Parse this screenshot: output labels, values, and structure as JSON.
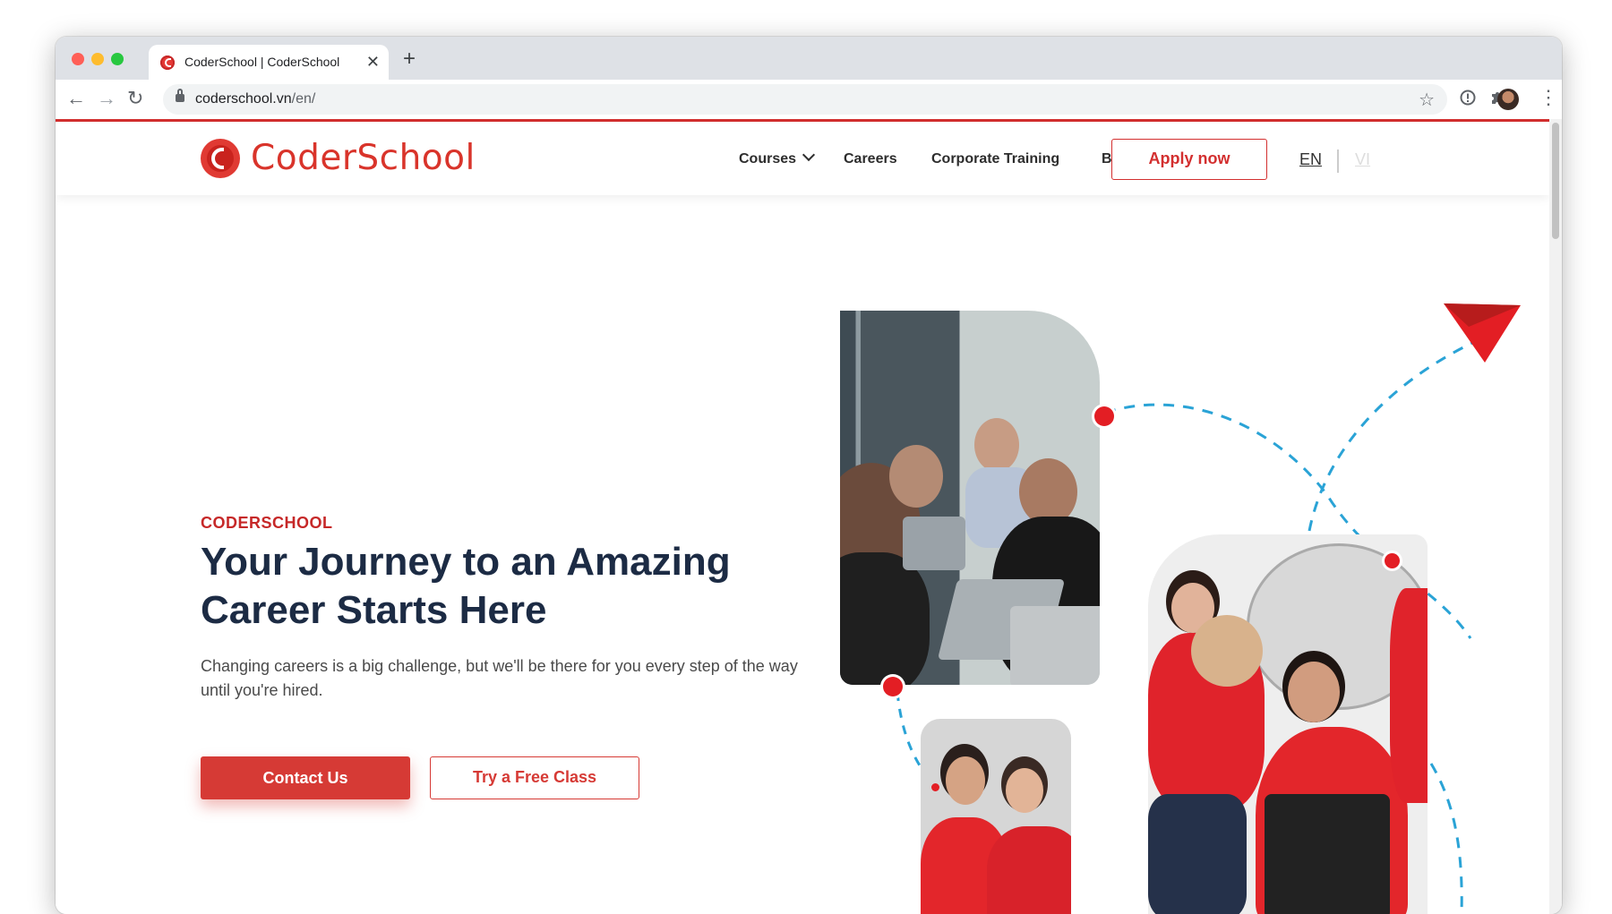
{
  "browser": {
    "tab_title": "CoderSchool | CoderSchool",
    "tab_close": "✕",
    "new_tab": "+",
    "url_host": "coderschool.vn",
    "url_path": "/en/",
    "back": "←",
    "forward": "→",
    "reload": "↻",
    "star": "☆",
    "menu": "⋮"
  },
  "site": {
    "logo_text": "CoderSchool",
    "nav": {
      "courses": "Courses",
      "careers": "Careers",
      "corporate": "Corporate Training",
      "blog": "Blog"
    },
    "apply_label": "Apply now",
    "lang_en": "EN",
    "lang_vi": "VI"
  },
  "hero": {
    "eyebrow": "CODERSCHOOL",
    "headline": "Your Journey to an Amazing Career Starts Here",
    "subtext": "Changing careers is a big challenge, but we'll be there for you every step of the way until you're hired.",
    "contact_label": "Contact Us",
    "free_class_label": "Try a Free Class"
  },
  "colors": {
    "brand_red": "#d63a35",
    "headline_navy": "#1c2b44",
    "dashed_line": "#2aa3d6"
  },
  "icons": [
    "red-circle-c-favicon",
    "lock-icon",
    "star-icon",
    "info-icon",
    "puzzle-icon",
    "avatar",
    "kebab-menu-icon",
    "chevron-down-icon",
    "paper-plane-icon"
  ]
}
